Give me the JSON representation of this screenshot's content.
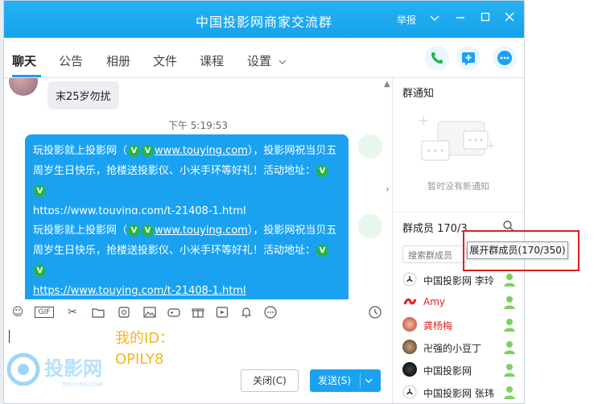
{
  "window": {
    "title": "中国投影网商家交流群",
    "report_label": "举报"
  },
  "tabs": [
    {
      "label": "聊天",
      "active": true
    },
    {
      "label": "公告"
    },
    {
      "label": "相册"
    },
    {
      "label": "文件"
    },
    {
      "label": "课程"
    },
    {
      "label": "设置"
    }
  ],
  "chat": {
    "prev_message": "末25岁勿扰",
    "timestamp": "下午 5:19:53",
    "messages": [
      {
        "text_before": "玩投影就上投影网（",
        "url_site": "www.touying.com",
        "text_middle": "），投影网祝当贝五周岁生日快乐，抢楼送投影仪、小米手环等好礼！活动地址：",
        "url_event": "https://www.touying.com/t-21408-1.html"
      },
      {
        "text_before": "玩投影就上投影网（",
        "url_site": "www.touying.com",
        "text_middle": "），投影网祝当贝五周岁生日快乐，抢楼送投影仪、小米手环等好礼！活动地址：",
        "url_event": "https://www.touying.com/t-21408-1.html"
      }
    ]
  },
  "input": {
    "overlay_text_line1": "我的ID：",
    "overlay_text_line2": "OPILY8",
    "watermark_text": "投影网",
    "watermark_sub": "TOUYING.COM",
    "close_label": "关闭(C)",
    "send_label": "发送(S)"
  },
  "side": {
    "notice_title": "群通知",
    "notice_empty": "暂时没有新通知",
    "members_title": "群成员 170/3",
    "search_placeholder": "搜索群成员",
    "tooltip": "展开群成员(170/350)",
    "members": [
      {
        "name": "中国投影网 李玲",
        "red": false
      },
      {
        "name": "Amy",
        "red": true
      },
      {
        "name": "龚杨梅",
        "red": true
      },
      {
        "name": "卍强的小豆丁",
        "red": false
      },
      {
        "name": "中国投影网",
        "red": false
      },
      {
        "name": "中国投影网 张玮",
        "red": false
      }
    ]
  },
  "colors": {
    "accent": "#1aa2f0",
    "titlebar": "#1aa8ee",
    "highlight": "#e01f1f",
    "overlay": "#f4b61c"
  }
}
